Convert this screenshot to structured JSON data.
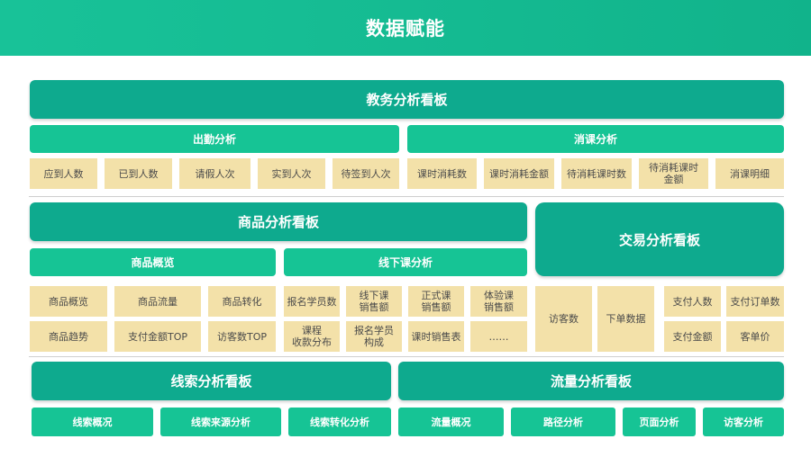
{
  "banner": {
    "title": "数据赋能"
  },
  "academic": {
    "title": "教务分析看板",
    "attendance": {
      "title": "出勤分析",
      "items": [
        "应到人数",
        "已到人数",
        "请假人次",
        "实到人次",
        "待签到人次"
      ]
    },
    "consumption": {
      "title": "消课分析",
      "items": [
        "课时消耗数",
        "课时消耗金额",
        "待消耗课时数",
        "待消耗课时\n金额",
        "消课明细"
      ]
    }
  },
  "product": {
    "title": "商品分析看板",
    "overview": {
      "title": "商品概览",
      "items": [
        "商品概览",
        "商品流量",
        "商品转化",
        "商品趋势",
        "支付金额TOP",
        "访客数TOP"
      ]
    },
    "offline": {
      "title": "线下课分析",
      "items": [
        "报名学员数",
        "线下课\n销售额",
        "正式课\n销售额",
        "体验课\n销售额",
        "课程\n收款分布",
        "报名学员\n构成",
        "课时销售表",
        "……"
      ]
    }
  },
  "trade": {
    "title": "交易分析看板",
    "items": [
      "访客数",
      "下单数据",
      "支付人数",
      "支付订单数",
      "支付金额",
      "客单价"
    ]
  },
  "leads": {
    "title": "线索分析看板",
    "items": [
      "线索概况",
      "线索来源分析",
      "线索转化分析"
    ]
  },
  "traffic": {
    "title": "流量分析看板",
    "items": [
      "流量概况",
      "路径分析",
      "页面分析",
      "访客分析"
    ]
  },
  "colors": {
    "banner": "#15bb92",
    "header": "#0eaa8e",
    "sub_header": "#16c495",
    "leaf": "#f3e1a9"
  }
}
